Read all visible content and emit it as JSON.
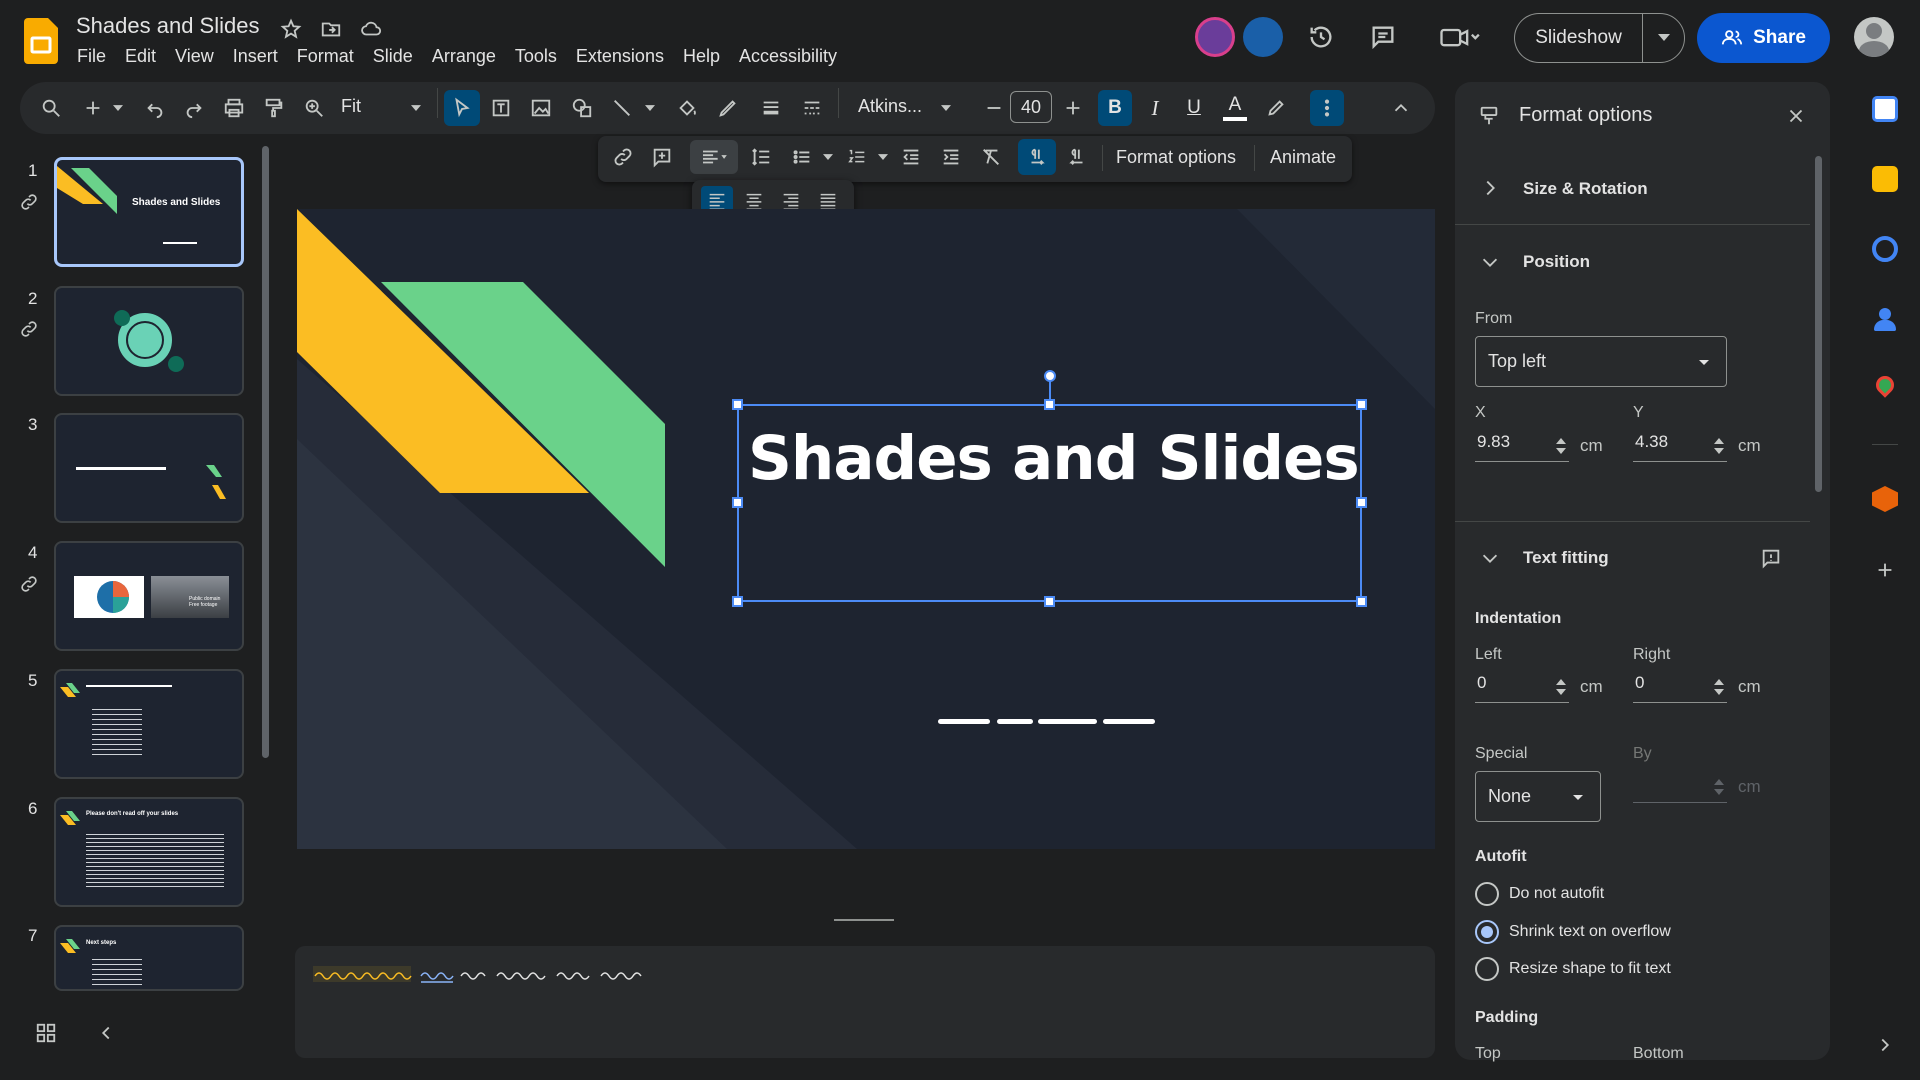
{
  "app": {
    "title": "Shades and Slides",
    "menu": [
      "File",
      "Edit",
      "View",
      "Insert",
      "Format",
      "Slide",
      "Arrange",
      "Tools",
      "Extensions",
      "Help",
      "Accessibility"
    ]
  },
  "header": {
    "slideshow_label": "Slideshow",
    "share_label": "Share"
  },
  "toolbar": {
    "zoom": "Fit",
    "font": "Atkins...",
    "font_size": "40"
  },
  "toolbar2": {
    "format_options_label": "Format options",
    "animate_label": "Animate"
  },
  "filmstrip": {
    "slides": [
      {
        "num": "1",
        "title": "Shades and Slides"
      },
      {
        "num": "2",
        "title": ""
      },
      {
        "num": "3",
        "title": ""
      },
      {
        "num": "4",
        "title": "Public domain Free footage"
      },
      {
        "num": "5",
        "title": ""
      },
      {
        "num": "6",
        "title": "Please don't read off your slides"
      },
      {
        "num": "7",
        "title": "Next steps"
      }
    ]
  },
  "slide": {
    "title": "Shades and Slides"
  },
  "panel": {
    "title": "Format options",
    "size_rotation": "Size & Rotation",
    "position": "Position",
    "from_label": "From",
    "from_value": "Top left",
    "x_label": "X",
    "x_value": "9.83",
    "y_label": "Y",
    "y_value": "4.38",
    "unit": "cm",
    "text_fitting": "Text fitting",
    "indentation": "Indentation",
    "left_label": "Left",
    "left_value": "0",
    "right_label": "Right",
    "right_value": "0",
    "special_label": "Special",
    "special_value": "None",
    "by_label": "By",
    "autofit": "Autofit",
    "autofit_options": [
      "Do not autofit",
      "Shrink text on overflow",
      "Resize shape to fit text"
    ],
    "autofit_selected": 1,
    "padding": "Padding",
    "top_label": "Top",
    "bottom_label": "Bottom"
  },
  "colors": {
    "accent": "#0b57d0",
    "selection": "#a8c7fa",
    "slide_bg": "#1e2430",
    "yellow": "#fbbd23",
    "green": "#6ad28a"
  }
}
